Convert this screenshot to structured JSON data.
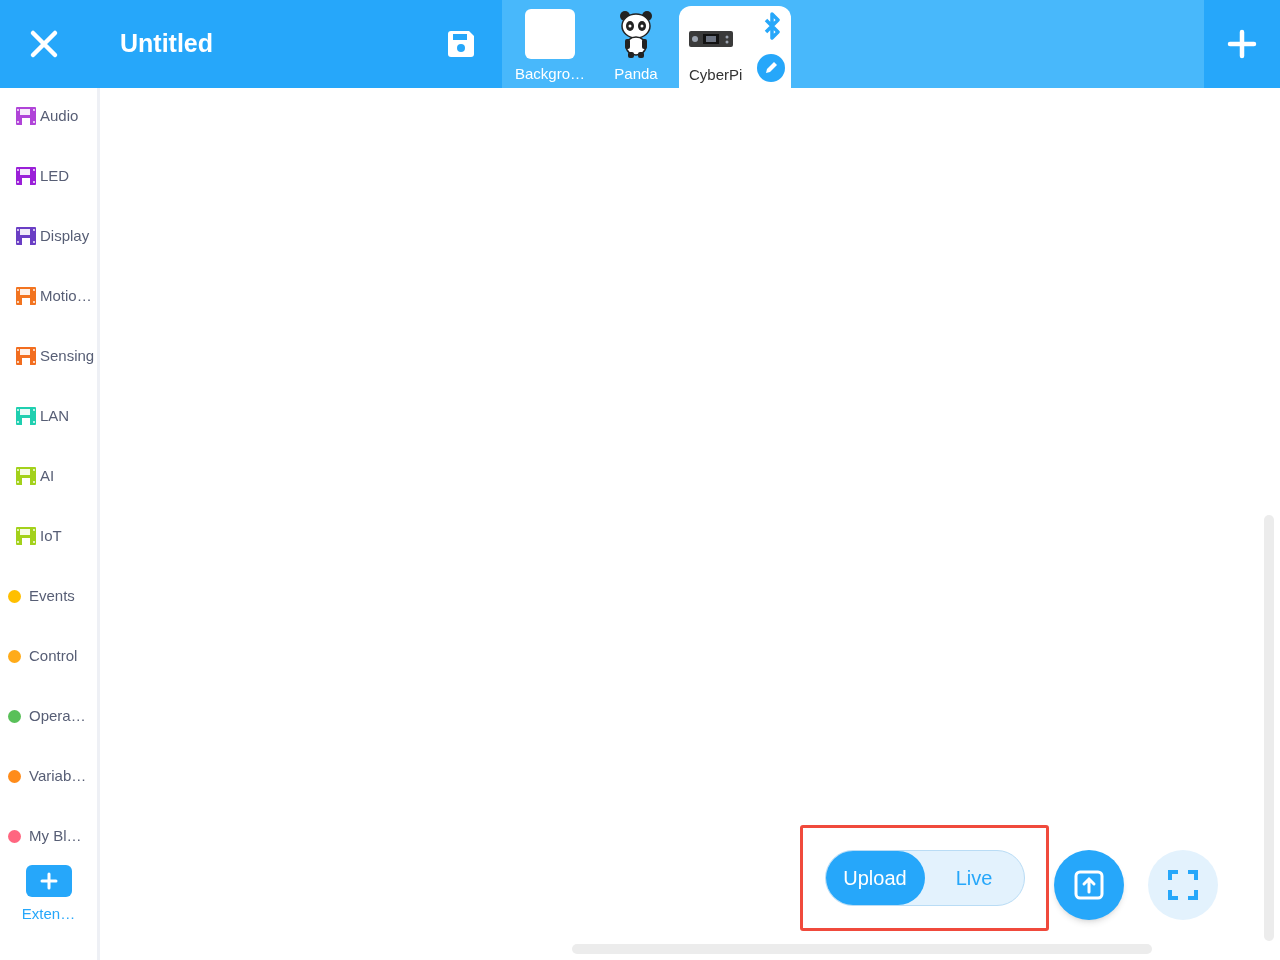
{
  "header": {
    "title": "Untitled"
  },
  "sprites": [
    {
      "label": "Backgro…",
      "kind": "backdrop",
      "selected": false
    },
    {
      "label": "Panda",
      "kind": "panda",
      "selected": false
    },
    {
      "label": "CyberPi",
      "kind": "device",
      "selected": true
    }
  ],
  "categories": [
    {
      "label": "Audio",
      "kind": "device",
      "color": "#b044d8"
    },
    {
      "label": "LED",
      "kind": "device",
      "color": "#9a1fd8"
    },
    {
      "label": "Display",
      "kind": "device",
      "color": "#6a3ec4"
    },
    {
      "label": "Motio…",
      "kind": "device",
      "color": "#f27420"
    },
    {
      "label": "Sensing",
      "kind": "device",
      "color": "#f26d1f"
    },
    {
      "label": "LAN",
      "kind": "device",
      "color": "#1fcfb0"
    },
    {
      "label": "AI",
      "kind": "device",
      "color": "#a3d11b"
    },
    {
      "label": "IoT",
      "kind": "device",
      "color": "#a3d11b"
    },
    {
      "label": "Events",
      "kind": "dot",
      "color": "#ffbf00"
    },
    {
      "label": "Control",
      "kind": "dot",
      "color": "#ffab19"
    },
    {
      "label": "Opera…",
      "kind": "dot",
      "color": "#59c059"
    },
    {
      "label": "Variab…",
      "kind": "dot",
      "color": "#ff8c1a"
    },
    {
      "label": "My Bl…",
      "kind": "dot",
      "color": "#ff6680"
    }
  ],
  "extension": {
    "label": "Exten…"
  },
  "mode_switch": [
    {
      "label": "Upload",
      "selected": true
    },
    {
      "label": "Live",
      "selected": false
    }
  ]
}
